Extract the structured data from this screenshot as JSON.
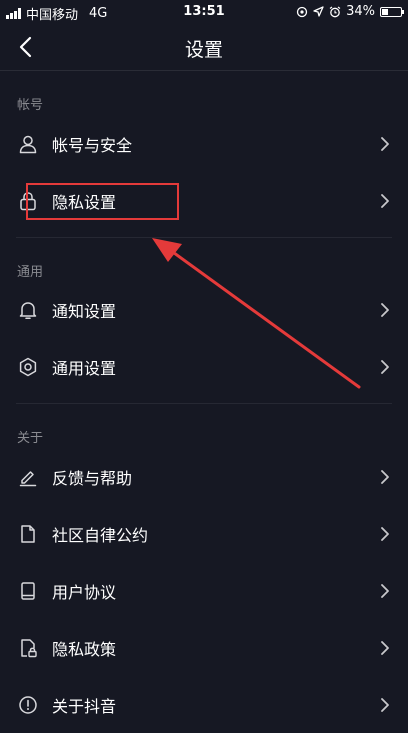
{
  "status_bar": {
    "carrier": "中国移动",
    "network": "4G",
    "time": "13:51",
    "battery_percent": "34%",
    "battery_level": 0.34
  },
  "nav": {
    "title": "设置",
    "back_icon": "chevron-left-icon"
  },
  "sections": [
    {
      "header": "帐号",
      "items": [
        {
          "label": "帐号与安全",
          "icon": "person-icon"
        },
        {
          "label": "隐私设置",
          "icon": "lock-icon"
        }
      ]
    },
    {
      "header": "通用",
      "items": [
        {
          "label": "通知设置",
          "icon": "bell-icon"
        },
        {
          "label": "通用设置",
          "icon": "gear-icon"
        }
      ]
    },
    {
      "header": "关于",
      "items": [
        {
          "label": "反馈与帮助",
          "icon": "edit-icon"
        },
        {
          "label": "社区自律公约",
          "icon": "document-icon"
        },
        {
          "label": "用户协议",
          "icon": "book-icon"
        },
        {
          "label": "隐私政策",
          "icon": "privacy-document-icon"
        },
        {
          "label": "关于抖音",
          "icon": "info-icon"
        }
      ]
    }
  ],
  "colors": {
    "background": "#161823",
    "annotation": "#e43a3a",
    "section_header": "#8a8b91"
  }
}
